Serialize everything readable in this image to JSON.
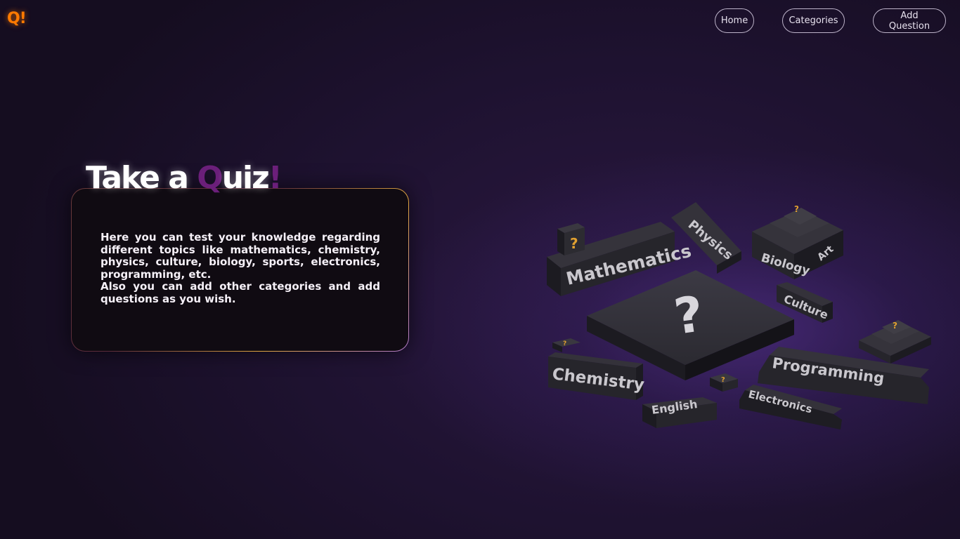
{
  "logo": {
    "text": "Q!"
  },
  "nav": [
    {
      "label": "Home"
    },
    {
      "label": "Categories"
    },
    {
      "label": "Add Question"
    }
  ],
  "hero": {
    "title_part1": "Take a ",
    "title_q": "Q",
    "title_rest": "uiz",
    "title_excl": "!",
    "description_1": "Here you can test your knowledge regarding different topics like mathematics, chemistry, physics, culture, biology, sports, electronics, programming, etc.",
    "description_2": "Also you can add other categories and add questions as you wish."
  },
  "illustration": {
    "blocks": [
      "Mathematics",
      "Physics",
      "Biology",
      "Art",
      "Culture",
      "Chemistry",
      "English",
      "Programming",
      "Electronics"
    ],
    "mark": "?"
  },
  "colors": {
    "accent_orange": "#ff7a00",
    "accent_purple": "#6b1f7a",
    "background": "#1e1230",
    "card": "#100b12"
  }
}
